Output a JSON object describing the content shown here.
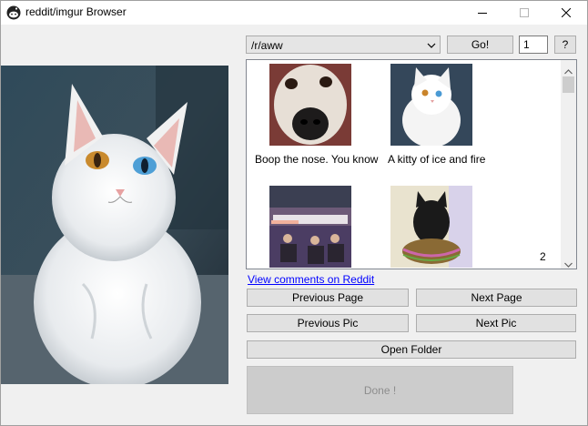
{
  "window": {
    "title": "reddit/imgur Browser",
    "icon": "reddit-alien-icon"
  },
  "controls": {
    "subreddit_value": "/r/aww",
    "go_label": "Go!",
    "page_number": "1",
    "help_label": "?"
  },
  "gallery": {
    "items": [
      {
        "caption": "Boop the nose. You know",
        "image": "dog-nose-thumbnail"
      },
      {
        "caption": "A kitty of ice and fire",
        "image": "white-cat-thumbnail"
      },
      {
        "caption": "",
        "image": "parliament-thumbnail"
      },
      {
        "caption": "",
        "image": "black-cat-basket-thumbnail"
      }
    ],
    "count": "2"
  },
  "comments_link": "View comments on Reddit",
  "buttons": {
    "previous_page": "Previous Page",
    "next_page": "Next Page",
    "previous_pic": "Previous Pic",
    "next_pic": "Next Pic",
    "open_folder": "Open Folder",
    "done": "Done !"
  },
  "main_image": "white-cat-heterochromia-photo"
}
